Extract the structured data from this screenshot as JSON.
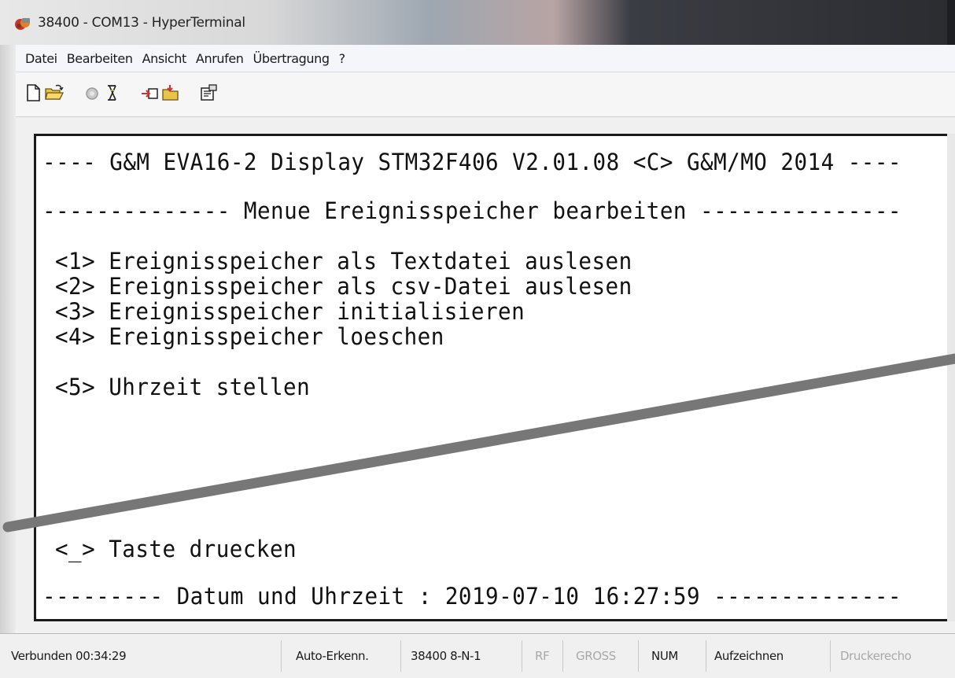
{
  "window": {
    "title": "38400 - COM13 - HyperTerminal"
  },
  "menu": {
    "items": [
      "Datei",
      "Bearbeiten",
      "Ansicht",
      "Anrufen",
      "Übertragung",
      "?"
    ]
  },
  "toolbar": {
    "buttons": [
      "new-document-icon",
      "open-folder-icon",
      "phone-icon",
      "disconnect-icon",
      "send-icon",
      "receive-icon",
      "properties-icon"
    ]
  },
  "terminal": {
    "lines": [
      "---- G&M EVA16-2 Display STM32F406 V2.01.08 <C> G&M/MO 2014 ----",
      "-------------- Menue Ereignisspeicher bearbeiten ---------------",
      "<1> Ereignisspeicher als Textdatei auslesen",
      "<2> Ereignisspeicher als csv-Datei auslesen",
      "<3> Ereignisspeicher initialisieren",
      "<4> Ereignisspeicher loeschen",
      "<5> Uhrzeit stellen",
      "<_> Taste druecken",
      "--------- Datum und Uhrzeit : 2019-07-10 16:27:59 --------------"
    ]
  },
  "statusbar": {
    "connection": "Verbunden 00:34:29",
    "detect": "Auto-Erkenn.",
    "settings": "38400 8-N-1",
    "scroll": "RF",
    "caps": "GROSS",
    "num": "NUM",
    "capture": "Aufzeichnen",
    "print_echo": "Druckerecho"
  },
  "colors": {
    "annotation_line": "#777777",
    "terminal_bg": "#ffffff",
    "terminal_text": "#111111"
  }
}
